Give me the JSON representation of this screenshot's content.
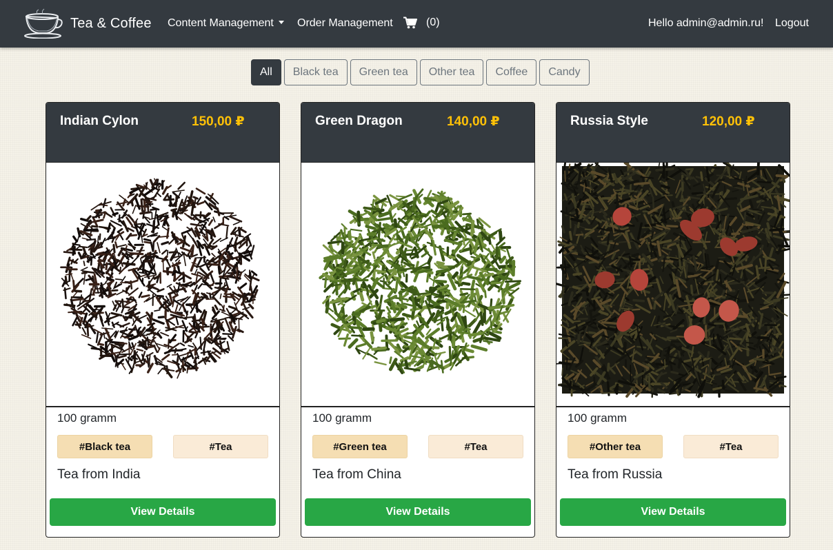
{
  "navbar": {
    "brand": "Tea & Coffee",
    "brand_icon": "teacup-logo-icon",
    "content_management": "Content Management",
    "order_management": "Order Management",
    "cart_icon": "shopping-cart-icon",
    "cart_count": "(0)",
    "greeting": "Hello admin@admin.ru!",
    "logout": "Logout",
    "background": "#343a40"
  },
  "filters": {
    "active": "All",
    "items": [
      "All",
      "Black tea",
      "Green tea",
      "Other tea",
      "Coffee",
      "Candy"
    ]
  },
  "products": [
    {
      "name": "Indian Cylon",
      "price": "150,00 ₽",
      "weight": "100 gramm",
      "tags": [
        "#Black tea",
        "#Tea"
      ],
      "description": "Tea from India",
      "button": "View Details"
    },
    {
      "name": "Green Dragon",
      "price": "140,00 ₽",
      "weight": "100 gramm",
      "tags": [
        "#Green tea",
        "#Tea"
      ],
      "description": "Tea from China",
      "button": "View Details"
    },
    {
      "name": "Russia Style",
      "price": "120,00 ₽",
      "weight": "100 gramm",
      "tags": [
        "#Other tea",
        "#Tea"
      ],
      "description": "Tea from Russia",
      "button": "View Details"
    }
  ],
  "colors": {
    "price": "#ffc107",
    "button": "#28a745",
    "tag_primary": "#f5deb3",
    "tag_secondary": "#faebd7"
  }
}
